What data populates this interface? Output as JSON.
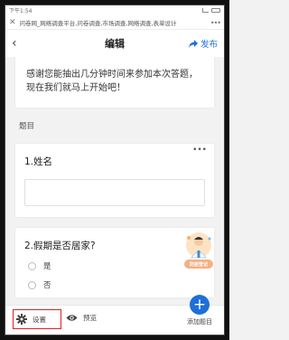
{
  "status_bar": {
    "time": "下午1:54"
  },
  "url_bar": {
    "title": "问卷网_网络调查平台,问卷调查,市场调查,网络调查,表单设计"
  },
  "header": {
    "title": "编辑",
    "publish_label": "发布"
  },
  "intro": {
    "text": "感谢您能抽出几分钟时间来参加本次答题，现在我们就马上开始吧！"
  },
  "section_label": "题目",
  "questions": [
    {
      "title": "1.姓名",
      "type": "text"
    },
    {
      "title": "2.假期是否居家?",
      "type": "radio",
      "options": [
        "是",
        "否"
      ]
    }
  ],
  "badge": {
    "label": "防疫登记"
  },
  "bottom_bar": {
    "settings_label": "设置",
    "preview_label": "预览",
    "add_label": "添加题目"
  },
  "colors": {
    "accent": "#1e6fd9",
    "highlight": "#dd2222",
    "badge": "#f4b183"
  }
}
